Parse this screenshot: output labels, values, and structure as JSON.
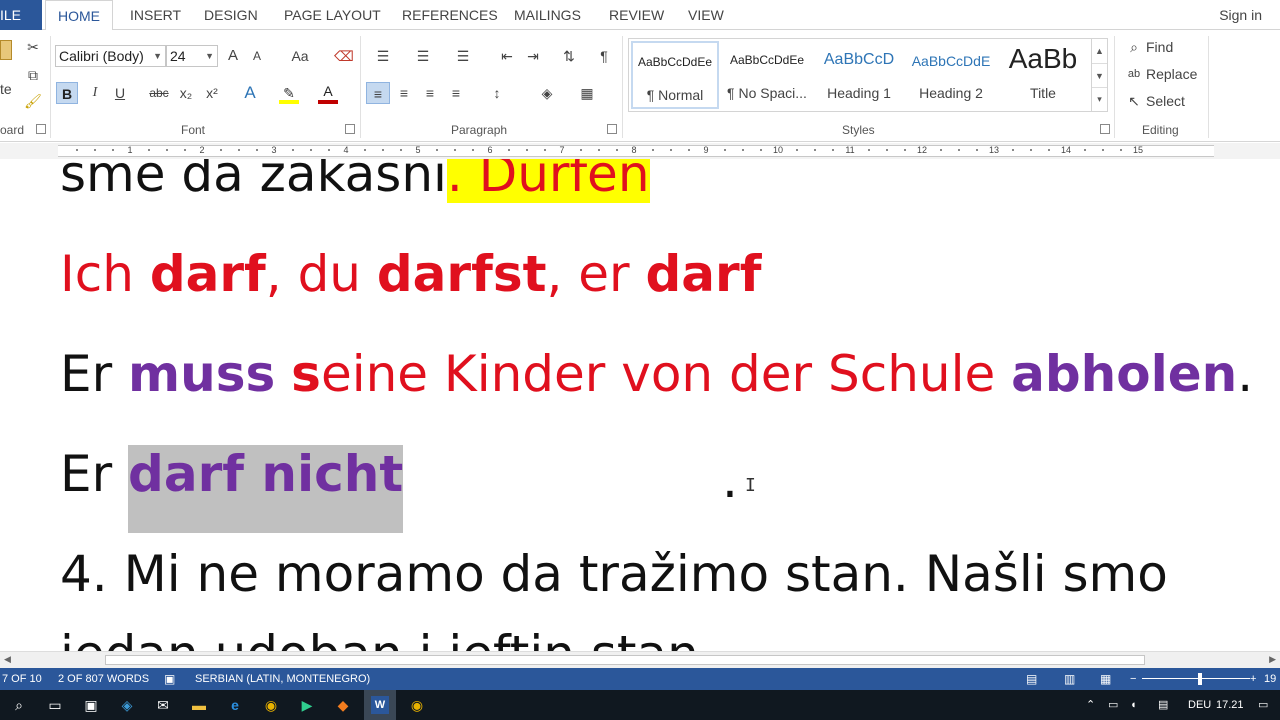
{
  "tabs": {
    "file": "ILE",
    "home": "HOME",
    "insert": "INSERT",
    "design": "DESIGN",
    "page_layout": "PAGE LAYOUT",
    "references": "REFERENCES",
    "mailings": "MAILINGS",
    "review": "REVIEW",
    "view": "VIEW",
    "signin": "Sign in"
  },
  "ribbon": {
    "clipboard_label": "oard",
    "paste_partial": "te",
    "font_name": "Calibri (Body)",
    "font_size": "24",
    "font_label": "Font",
    "paragraph_label": "Paragraph",
    "styles_label": "Styles",
    "editing_label": "Editing",
    "bold": "B",
    "italic": "I",
    "underline": "U",
    "strike": "abc",
    "subscript": "x₂",
    "superscript": "x²",
    "grow": "A",
    "shrink": "A",
    "change_case": "Aa",
    "pilcrow": "¶",
    "styles": [
      {
        "preview": "AaBbCcDdEe",
        "name": "¶ Normal"
      },
      {
        "preview": "AaBbCcDdEe",
        "name": "¶ No Spaci..."
      },
      {
        "preview": "AaBbCcD",
        "name": "Heading 1"
      },
      {
        "preview": "AaBbCcDdE",
        "name": "Heading 2"
      },
      {
        "preview": "AaBb",
        "name": "Title"
      }
    ],
    "find": "Find",
    "replace": "Replace",
    "select": "Select"
  },
  "ruler": {
    "ticks": [
      "1",
      "2",
      "3",
      "4",
      "5",
      "6",
      "7",
      "8",
      "9",
      "10",
      "11",
      "12",
      "13",
      "14",
      "15"
    ]
  },
  "document": {
    "line1_a": "sme da zakasni",
    "line1_b": ". Dürfen",
    "line2_a": "Ich ",
    "line2_b": "darf",
    "line2_c": ", du ",
    "line2_d": "darfst",
    "line2_e": ", er ",
    "line2_f": "darf",
    "line3_a": "Er ",
    "line3_b": "muss",
    "line3_c": " ",
    "line3_d": "s",
    "line3_e": "eine Kinder von der Schule ",
    "line3_f": "abholen",
    "line3_g": ".",
    "line4_a": "Er ",
    "line4_b": "darf nicht",
    "line4_dot": ".",
    "line5": "4. Mi ne moramo da tražimo stan. Našli smo",
    "line6": "jedan udoban i jeftin stan."
  },
  "status": {
    "page": "7 OF 10",
    "words": "2 OF 807 WORDS",
    "language": "SERBIAN (LATIN, MONTENEGRO)",
    "zoom": "19"
  },
  "taskbar": {
    "lang": "DEU",
    "time": "17.21"
  }
}
